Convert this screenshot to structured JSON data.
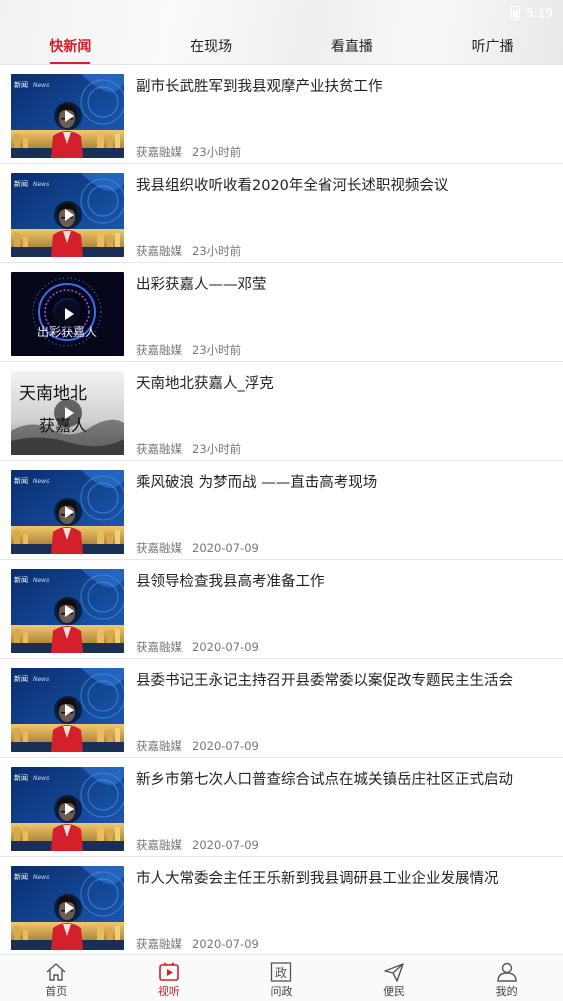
{
  "status": {
    "time": "5:19"
  },
  "tabs": [
    {
      "label": "快新闻",
      "active": true
    },
    {
      "label": "在现场",
      "active": false
    },
    {
      "label": "看直播",
      "active": false
    },
    {
      "label": "听广播",
      "active": false
    }
  ],
  "news": [
    {
      "title": "副市长武胜军到我县观摩产业扶贫工作",
      "source": "获嘉融媒",
      "time": "23小时前",
      "thumb": "anchor"
    },
    {
      "title": "我县组织收听收看2020年全省河长述职视频会议",
      "source": "获嘉融媒",
      "time": "23小时前",
      "thumb": "anchor"
    },
    {
      "title": "出彩获嘉人——邓莹",
      "source": "获嘉融媒",
      "time": "23小时前",
      "thumb": "emblem"
    },
    {
      "title": "天南地北获嘉人_浮克",
      "source": "获嘉融媒",
      "time": "23小时前",
      "thumb": "calligraphy"
    },
    {
      "title": "乘风破浪 为梦而战 ——直击高考现场",
      "source": "获嘉融媒",
      "time": "2020-07-09",
      "thumb": "anchor"
    },
    {
      "title": "县领导检查我县高考准备工作",
      "source": "获嘉融媒",
      "time": "2020-07-09",
      "thumb": "anchor"
    },
    {
      "title": "县委书记王永记主持召开县委常委以案促改专题民主生活会",
      "source": "获嘉融媒",
      "time": "2020-07-09",
      "thumb": "anchor"
    },
    {
      "title": "新乡市第七次人口普查综合试点在城关镇岳庄社区正式启动",
      "source": "获嘉融媒",
      "time": "2020-07-09",
      "thumb": "anchor"
    },
    {
      "title": "市人大常委会主任王乐新到我县调研县工业企业发展情况",
      "source": "获嘉融媒",
      "time": "2020-07-09",
      "thumb": "anchor"
    }
  ],
  "thumb_text": {
    "anchor_brand": "新闻",
    "anchor_en": "News",
    "emblem_caption": "出彩获嘉人",
    "calligraphy_line1": "天南地北",
    "calligraphy_line2": "获嘉人"
  },
  "tabbar": [
    {
      "label": "首页",
      "icon": "home-icon",
      "active": false
    },
    {
      "label": "视听",
      "icon": "play-icon",
      "active": true
    },
    {
      "label": "问政",
      "icon": "zheng-icon",
      "active": false,
      "icon_text": "政"
    },
    {
      "label": "便民",
      "icon": "send-icon",
      "active": false
    },
    {
      "label": "我的",
      "icon": "user-icon",
      "active": false
    }
  ],
  "colors": {
    "accent": "#d3212b",
    "text": "#222222",
    "meta": "#777777"
  }
}
